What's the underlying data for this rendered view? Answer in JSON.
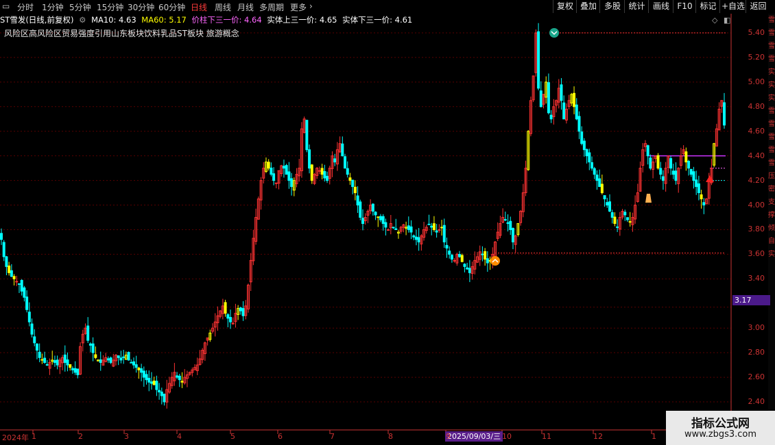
{
  "toolbar": {
    "timeframes": [
      "分时",
      "1分钟",
      "5分钟",
      "15分钟",
      "30分钟",
      "60分钟",
      "日线",
      "周线",
      "月线",
      "多周期",
      "更多"
    ],
    "active": "日线",
    "right_buttons": [
      "复权",
      "叠加",
      "多股",
      "统计",
      "画线",
      "F10",
      "标记",
      "+自选",
      "返回"
    ]
  },
  "info": {
    "title": "ST雪发(日线,前复权)",
    "ma10": "MA10: 4.63",
    "ma60": "MA60: 5.17",
    "line1": "价柱下三一价: 4.64",
    "line2": "实体上三一价: 4.65",
    "line3": "实体下三一价: 4.61",
    "colors": {
      "title": "#ffffff",
      "ma10": "#ffffff",
      "ma60": "#ffff00",
      "line1": "#ff66ff",
      "line2": "#ffffff",
      "line3": "#ffffff"
    }
  },
  "concepts": "风险区高风险区贸易强度引用山东板块饮料乳品ST板块 旅游概念",
  "y_axis": {
    "labels": [
      "5.40",
      "5.20",
      "5.00",
      "4.80",
      "4.60",
      "4.40",
      "4.20",
      "4.00",
      "3.80",
      "3.60",
      "3.40",
      "3.17",
      "3.00",
      "2.80",
      "2.60",
      "2.40"
    ],
    "current_price": "3.17"
  },
  "x_axis": {
    "labels": [
      "2024年",
      "1",
      "2",
      "3",
      "4",
      "5",
      "6",
      "7",
      "8",
      "9",
      "10",
      "11",
      "12",
      "1"
    ],
    "cursor_date": "2025/09/03/三"
  },
  "right_column_text": [
    "雪",
    "雪",
    "雪",
    "雪",
    "实",
    "实",
    "实",
    "雪",
    "雪",
    "雪",
    "雪",
    "雪",
    "压",
    "密",
    "支",
    "撑",
    "倾",
    "自",
    "实"
  ],
  "watermark": {
    "title": "指标公式网",
    "url": "www.zbgs3.com"
  },
  "colors": {
    "up": "#ff3333",
    "down": "#00ffff",
    "highlight": "#ffff00",
    "grid": "#5a0000",
    "axis": "#cc3333",
    "purple": "#cc33ff"
  },
  "chart_data": {
    "type": "candlestick",
    "ylim": [
      2.3,
      5.52
    ],
    "levels": [
      5.4,
      3.61,
      4.4,
      4.3,
      4.2
    ],
    "closes": [
      3.72,
      3.58,
      3.5,
      3.45,
      3.42,
      3.4,
      3.38,
      3.36,
      3.3,
      3.25,
      3.15,
      3.05,
      2.95,
      2.88,
      2.82,
      2.76,
      2.74,
      2.72,
      2.7,
      2.72,
      2.74,
      2.72,
      2.7,
      2.74,
      2.76,
      2.72,
      2.7,
      2.68,
      2.66,
      2.64,
      2.62,
      2.85,
      2.95,
      3.0,
      2.9,
      2.86,
      2.8,
      2.76,
      2.74,
      2.72,
      2.74,
      2.76,
      2.74,
      2.72,
      2.74,
      2.78,
      2.76,
      2.74,
      2.76,
      2.78,
      2.74,
      2.72,
      2.7,
      2.68,
      2.66,
      2.64,
      2.6,
      2.58,
      2.56,
      2.55,
      2.54,
      2.5,
      2.48,
      2.45,
      2.4,
      2.5,
      2.55,
      2.6,
      2.64,
      2.6,
      2.58,
      2.56,
      2.6,
      2.62,
      2.64,
      2.66,
      2.68,
      2.7,
      2.75,
      2.82,
      2.88,
      2.92,
      2.96,
      3.0,
      3.05,
      3.1,
      3.14,
      3.18,
      3.12,
      3.08,
      3.05,
      3.04,
      3.12,
      3.16,
      3.14,
      3.1,
      3.18,
      3.35,
      3.55,
      3.73,
      3.9,
      4.05,
      4.2,
      4.3,
      4.35,
      4.3,
      4.25,
      4.2,
      4.18,
      4.28,
      4.32,
      4.3,
      4.25,
      4.2,
      4.15,
      4.2,
      4.25,
      4.3,
      4.62,
      4.7,
      4.45,
      4.3,
      4.2,
      4.25,
      4.3,
      4.28,
      4.25,
      4.22,
      4.2,
      4.3,
      4.4,
      4.35,
      4.45,
      4.5,
      4.4,
      4.3,
      4.25,
      4.2,
      4.15,
      4.1,
      4.0,
      3.9,
      3.85,
      3.9,
      3.95,
      4.0,
      3.95,
      3.92,
      3.9,
      3.88,
      3.85,
      3.82,
      3.8,
      3.85,
      3.82,
      3.8,
      3.78,
      3.82,
      3.84,
      3.82,
      3.8,
      3.78,
      3.74,
      3.72,
      3.7,
      3.75,
      3.8,
      3.82,
      3.84,
      3.82,
      3.8,
      3.78,
      3.8,
      3.82,
      3.7,
      3.65,
      3.6,
      3.56,
      3.55,
      3.6,
      3.58,
      3.54,
      3.5,
      3.48,
      3.45,
      3.5,
      3.55,
      3.58,
      3.62,
      3.6,
      3.56,
      3.53,
      3.55,
      3.6,
      3.7,
      3.78,
      3.85,
      3.9,
      3.88,
      3.85,
      3.8,
      3.7,
      3.75,
      3.85,
      3.95,
      4.1,
      4.3,
      4.6,
      4.85,
      5.05,
      5.4,
      4.95,
      4.8,
      4.9,
      5.0,
      4.75,
      4.7,
      4.8,
      4.85,
      4.95,
      4.85,
      4.7,
      4.78,
      4.85,
      4.9,
      4.8,
      4.7,
      4.6,
      4.5,
      4.45,
      4.4,
      4.35,
      4.3,
      4.25,
      4.2,
      4.15,
      4.1,
      4.05,
      4.0,
      3.95,
      3.9,
      3.85,
      3.82,
      3.9,
      3.95,
      3.92,
      3.88,
      3.86,
      3.9,
      4.0,
      4.1,
      4.3,
      4.45,
      4.5,
      4.4,
      4.3,
      4.35,
      4.4,
      4.3,
      4.25,
      4.2,
      4.3,
      4.4,
      4.3,
      4.25,
      4.2,
      4.3,
      4.4,
      4.45,
      4.35,
      4.3,
      4.25,
      4.2,
      4.15,
      4.1,
      4.05,
      4.0,
      4.05,
      4.2,
      4.3,
      4.5,
      4.62,
      4.78,
      4.85,
      4.65
    ]
  }
}
